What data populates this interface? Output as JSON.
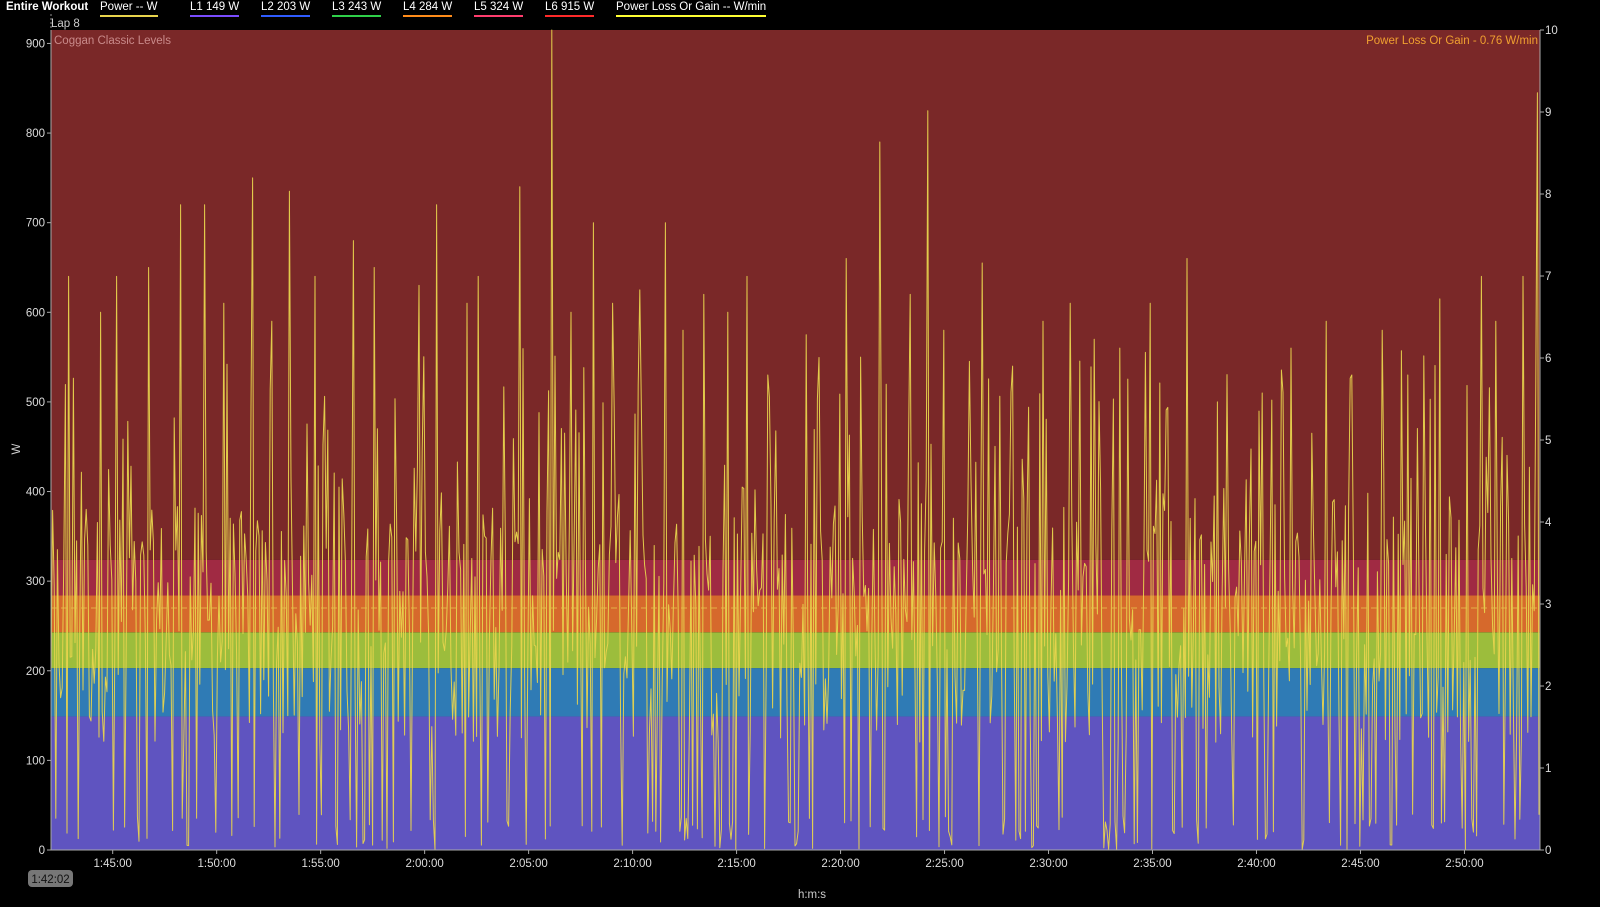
{
  "header": {
    "workout_label": "Entire Workout",
    "legend": [
      {
        "label": "Power  -- W",
        "color": "#e8d44d"
      },
      {
        "label": "L1  149 W",
        "color": "#7a4cff"
      },
      {
        "label": "L2  203 W",
        "color": "#2f5cff"
      },
      {
        "label": "L3  243 W",
        "color": "#2fd04a"
      },
      {
        "label": "L4  284 W",
        "color": "#ff8c1a"
      },
      {
        "label": "L5  324 W",
        "color": "#ff3d6e"
      },
      {
        "label": "L6  915 W",
        "color": "#ff2a2a"
      },
      {
        "label": "Power Loss Or Gain  -- W/min",
        "color": "#ffff33"
      }
    ]
  },
  "chart_data": {
    "type": "area",
    "lap_label": "Lap 8",
    "zones_label": "Coggan Classic Levels",
    "annotation": "Power Loss Or Gain - 0.76 W/min",
    "annotation_color": "#f0a030",
    "xlabel": "h:m:s",
    "ylabel": "W",
    "ylim": [
      0,
      915
    ],
    "y2lim": [
      0,
      10
    ],
    "xlim_seconds": [
      6122,
      10418
    ],
    "start_label": "1:42:02",
    "x_ticks": [
      "1:45:00",
      "1:50:00",
      "1:55:00",
      "2:00:00",
      "2:05:00",
      "2:10:00",
      "2:15:00",
      "2:20:00",
      "2:25:00",
      "2:30:00",
      "2:35:00",
      "2:40:00",
      "2:45:00",
      "2:50:00"
    ],
    "y_ticks": [
      "0",
      "100",
      "200",
      "300",
      "400",
      "500",
      "600",
      "700",
      "800",
      "900"
    ],
    "y2_ticks": [
      "0",
      "1",
      "2",
      "3",
      "4",
      "5",
      "6",
      "7",
      "8",
      "9",
      "10"
    ],
    "zones": [
      {
        "name": "L1",
        "from": 0,
        "to": 149,
        "color": "#5f54c0"
      },
      {
        "name": "L2",
        "from": 149,
        "to": 203,
        "color": "#2f7bb5"
      },
      {
        "name": "L3",
        "from": 203,
        "to": 243,
        "color": "#9cbd3c"
      },
      {
        "name": "L4",
        "from": 243,
        "to": 284,
        "color": "#d6692c"
      },
      {
        "name": "L5",
        "from": 284,
        "to": 324,
        "color": "#a02a43"
      },
      {
        "name": "L6",
        "from": 324,
        "to": 915,
        "color": "#7a2828"
      }
    ],
    "average_line_w": 270,
    "series": [
      {
        "name": "Power",
        "color": "#e8d44d",
        "peaks": [
          {
            "t": 6175,
            "w": 640
          },
          {
            "t": 6263,
            "w": 600
          },
          {
            "t": 6310,
            "w": 640
          },
          {
            "t": 6405,
            "w": 650
          },
          {
            "t": 6496,
            "w": 720
          },
          {
            "t": 6566,
            "w": 720
          },
          {
            "t": 6620,
            "w": 610
          },
          {
            "t": 6705,
            "w": 750
          },
          {
            "t": 6760,
            "w": 590
          },
          {
            "t": 6812,
            "w": 735
          },
          {
            "t": 6882,
            "w": 640
          },
          {
            "t": 6994,
            "w": 680
          },
          {
            "t": 7056,
            "w": 650
          },
          {
            "t": 7182,
            "w": 630
          },
          {
            "t": 7234,
            "w": 720
          },
          {
            "t": 7320,
            "w": 610
          },
          {
            "t": 7356,
            "w": 640
          },
          {
            "t": 7475,
            "w": 740
          },
          {
            "t": 7567,
            "w": 915
          },
          {
            "t": 7623,
            "w": 600
          },
          {
            "t": 7688,
            "w": 700
          },
          {
            "t": 7744,
            "w": 610
          },
          {
            "t": 7820,
            "w": 625
          },
          {
            "t": 7894,
            "w": 700
          },
          {
            "t": 7947,
            "w": 580
          },
          {
            "t": 8007,
            "w": 620
          },
          {
            "t": 8075,
            "w": 600
          },
          {
            "t": 8129,
            "w": 640
          },
          {
            "t": 8191,
            "w": 530
          },
          {
            "t": 8300,
            "w": 575
          },
          {
            "t": 8415,
            "w": 660
          },
          {
            "t": 8458,
            "w": 550
          },
          {
            "t": 8513,
            "w": 790
          },
          {
            "t": 8601,
            "w": 620
          },
          {
            "t": 8654,
            "w": 825
          },
          {
            "t": 8700,
            "w": 580
          },
          {
            "t": 8807,
            "w": 655
          },
          {
            "t": 8898,
            "w": 540
          },
          {
            "t": 8985,
            "w": 590
          },
          {
            "t": 9064,
            "w": 610
          },
          {
            "t": 9130,
            "w": 570
          },
          {
            "t": 9206,
            "w": 560
          },
          {
            "t": 9294,
            "w": 610
          },
          {
            "t": 9399,
            "w": 660
          },
          {
            "t": 9488,
            "w": 500
          },
          {
            "t": 9618,
            "w": 510
          },
          {
            "t": 9700,
            "w": 560
          },
          {
            "t": 9760,
            "w": 465
          },
          {
            "t": 9803,
            "w": 590
          },
          {
            "t": 9873,
            "w": 530
          },
          {
            "t": 9963,
            "w": 580
          },
          {
            "t": 10035,
            "w": 530
          },
          {
            "t": 10129,
            "w": 615
          },
          {
            "t": 10248,
            "w": 640
          },
          {
            "t": 10290,
            "w": 590
          },
          {
            "t": 10370,
            "w": 640
          },
          {
            "t": 10410,
            "w": 845
          }
        ]
      }
    ]
  }
}
